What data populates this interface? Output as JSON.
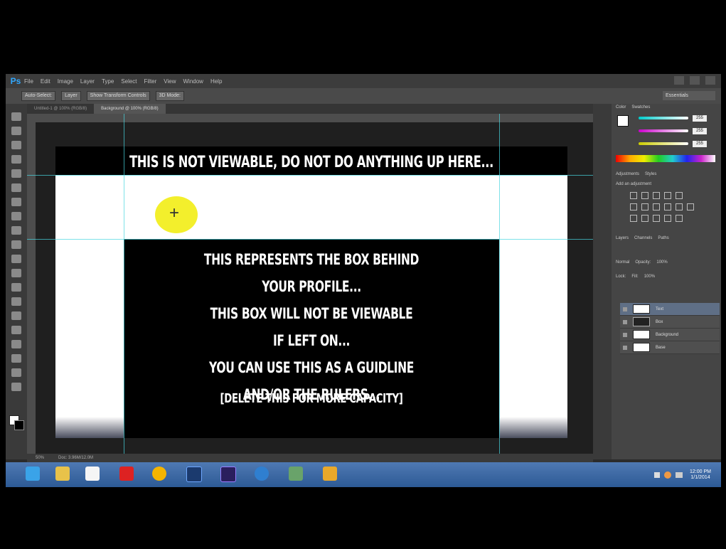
{
  "app": {
    "logo": "Ps"
  },
  "menubar": {
    "items": [
      "File",
      "Edit",
      "Image",
      "Layer",
      "Type",
      "Select",
      "Filter",
      "View",
      "Window",
      "Help"
    ]
  },
  "options": {
    "auto_select": "Auto-Select:",
    "layer": "Layer",
    "transform": "Show Transform Controls",
    "mode": "3D Mode:",
    "workspace": "Essentials"
  },
  "tabs": [
    {
      "label": "Untitled-1 @ 100% (RGB/8)",
      "active": false
    },
    {
      "label": "Background @ 100% (RGB/8)",
      "active": true
    }
  ],
  "canvas": {
    "top_note": "THIS IS NOT VIEWABLE, DO NOT DO ANYTHING UP HERE...",
    "box_lines": [
      "THIS REPRESENTS THE BOX BEHIND",
      "YOUR PROFILE...",
      "THIS BOX WILL NOT BE VIEWABLE",
      "IF LEFT ON...",
      "YOU CAN USE THIS AS A GUIDLINE",
      "AND/OR THE RULERS..."
    ],
    "box_note": "[DELETE THIS FOR MORE CAPACITY]"
  },
  "status": {
    "zoom": "50%",
    "doc": "Doc: 3.96M/12.0M"
  },
  "panels": {
    "color_tabs": [
      "Color",
      "Swatches"
    ],
    "color_values": [
      "255",
      "255",
      "255"
    ],
    "adjust_tabs": [
      "Adjustments",
      "Styles"
    ],
    "adjust_label": "Add an adjustment",
    "layers_tabs": [
      "Layers",
      "Channels",
      "Paths"
    ],
    "blend_mode": "Normal",
    "opacity_label": "Opacity:",
    "opacity_value": "100%",
    "lock_label": "Lock:",
    "fill_label": "Fill:",
    "fill_value": "100%",
    "layers": [
      {
        "name": "Text",
        "selected": true,
        "dark": false
      },
      {
        "name": "Box",
        "selected": false,
        "dark": true
      },
      {
        "name": "Background",
        "selected": false,
        "dark": false
      },
      {
        "name": "Base",
        "selected": false,
        "dark": false
      }
    ]
  },
  "taskbar": {
    "icons": [
      "ie-icon",
      "explorer-icon",
      "amazon-icon",
      "power-icon",
      "chrome-icon",
      "photoshop-icon",
      "premiere-icon",
      "media-icon",
      "network-icon",
      "security-icon"
    ],
    "clock_time": "12:00 PM",
    "clock_date": "1/1/2014"
  },
  "colors": {
    "taskbar": "#3a67a4",
    "highlight": "#f2ee1a",
    "guide": "#47d6e0"
  }
}
